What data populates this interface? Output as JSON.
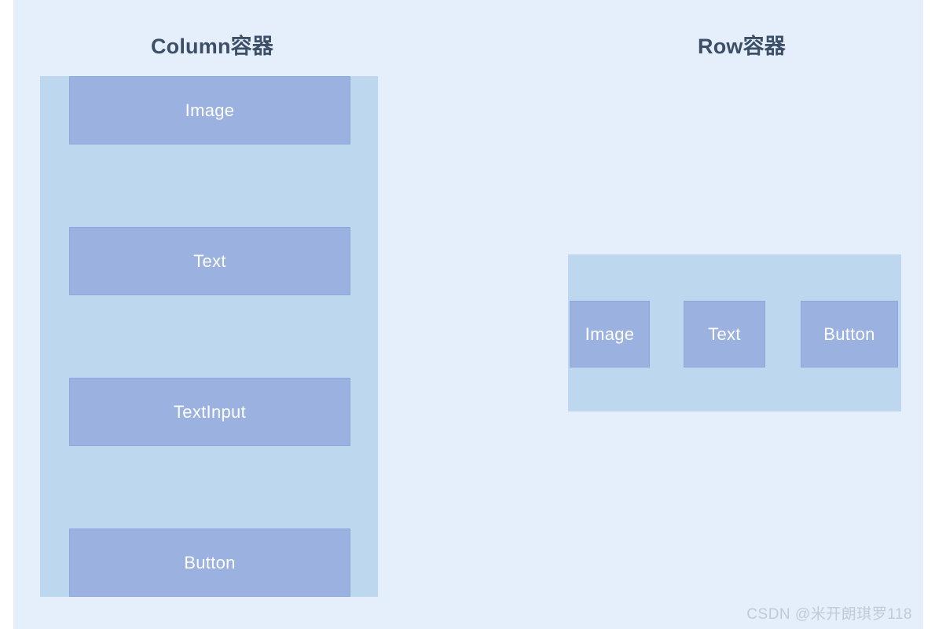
{
  "canvas": {
    "background_color": "#E4EFFB",
    "container_fill": "#BDD7EE",
    "box_fill": "#9BB1E0",
    "box_border": "#8FA8DC",
    "title_color": "#3D4F66",
    "box_label_color": "#FFFFFF",
    "watermark_color": "#C2CAD6"
  },
  "sections": {
    "column": {
      "title": "Column容器",
      "children": [
        {
          "label": "Image"
        },
        {
          "label": "Text"
        },
        {
          "label": "TextInput"
        },
        {
          "label": "Button"
        }
      ]
    },
    "row": {
      "title": "Row容器",
      "children": [
        {
          "label": "Image"
        },
        {
          "label": "Text"
        },
        {
          "label": "Button"
        }
      ]
    }
  },
  "watermark": {
    "text": "CSDN @米开朗琪罗118"
  }
}
